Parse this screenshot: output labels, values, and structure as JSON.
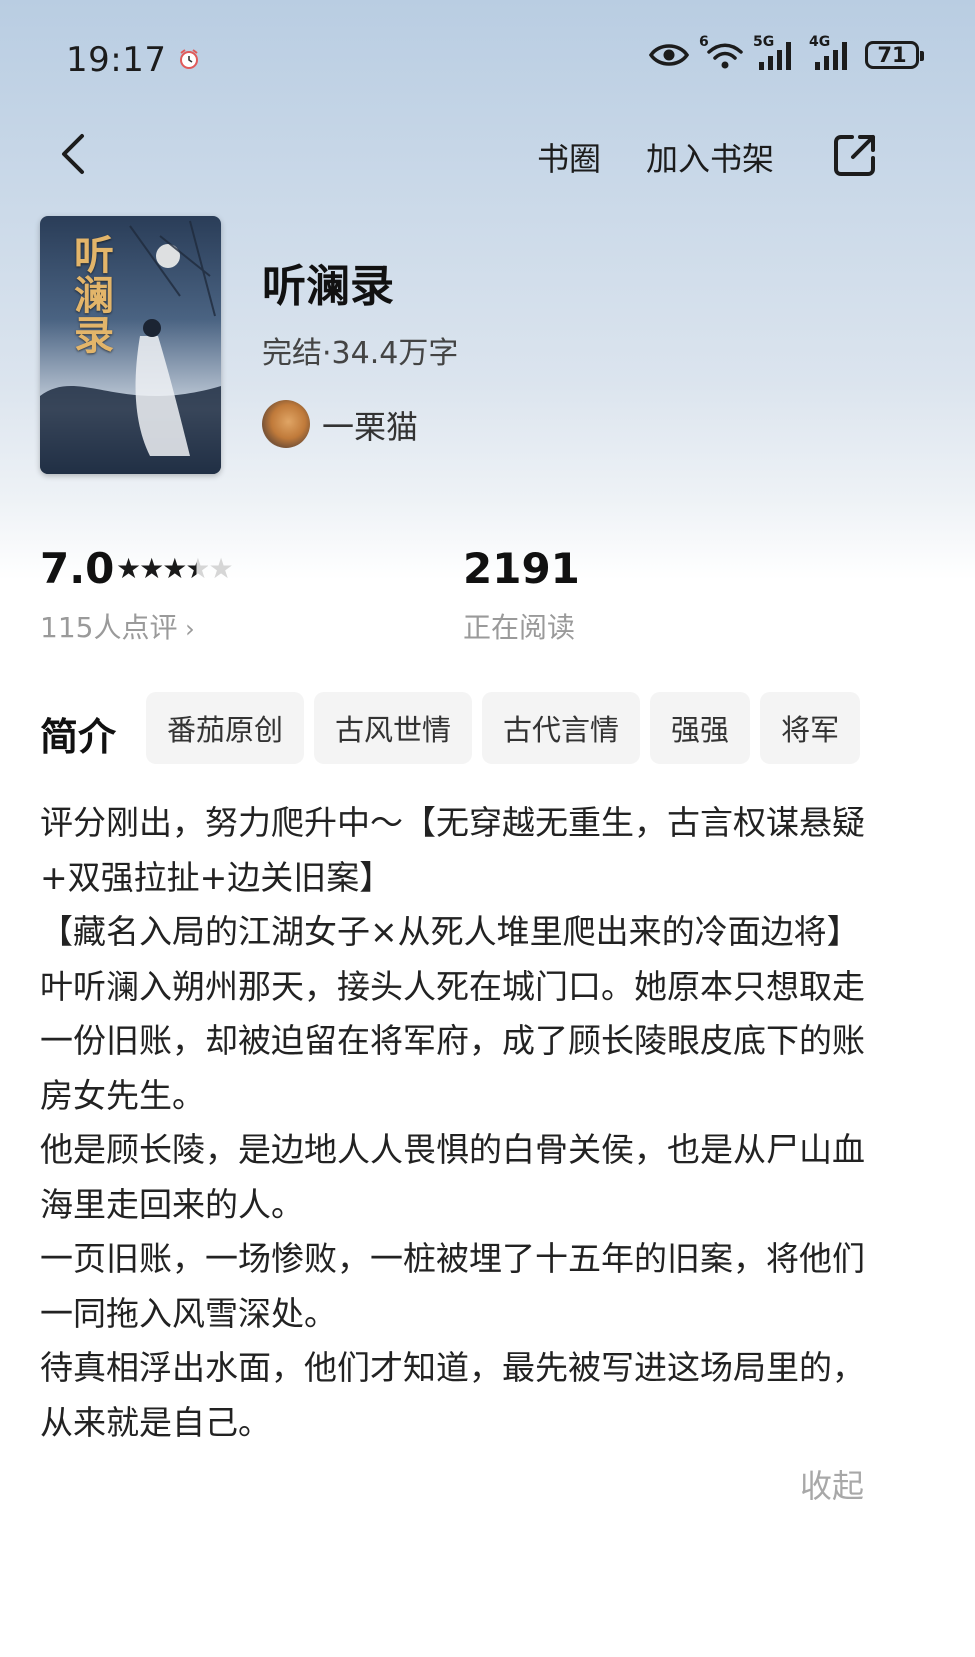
{
  "status_bar": {
    "time": "19:17",
    "battery": "71",
    "signal_labels": [
      "6",
      "5G",
      "4G"
    ],
    "icons": [
      "alarm-icon",
      "eye-icon",
      "wifi-icon",
      "signal-icon",
      "battery-icon"
    ]
  },
  "nav": {
    "back_icon": "chevron-left-icon",
    "book_circle": "书圈",
    "add_to_shelf": "加入书架",
    "share_icon": "share-icon"
  },
  "book": {
    "cover_text": "听澜录",
    "title": "听澜录",
    "meta": "完结·34.4万字",
    "author": "一栗猫"
  },
  "stats": {
    "score": "7.0",
    "rating_stars": 3.5,
    "max_stars": 5,
    "review_count": "115人点评",
    "reading_count": "2191",
    "reading_label": "正在阅读"
  },
  "intro": {
    "label": "简介",
    "tags": [
      "番茄原创",
      "古风世情",
      "古代言情",
      "强强",
      "将军"
    ],
    "paragraphs": [
      "评分刚出，努力爬升中～【无穿越无重生，古言权谋悬疑+双强拉扯+边关旧案】",
      "【藏名入局的江湖女子×从死人堆里爬出来的冷面边将】",
      "叶听澜入朔州那天，接头人死在城门口。她原本只想取走一份旧账，却被迫留在将军府，成了顾长陵眼皮底下的账房女先生。",
      "他是顾长陵，是边地人人畏惧的白骨关侯，也是从尸山血海里走回来的人。",
      "一页旧账，一场惨败，一桩被埋了十五年的旧案，将他们一同拖入风雪深处。",
      "待真相浮出水面，他们才知道，最先被写进这场局里的，从来就是自己。"
    ],
    "collapse": "收起"
  },
  "colors": {
    "header_gradient_top": "#b9cde2",
    "text_primary": "#111111",
    "text_secondary": "#9a9a9a",
    "tag_background": "#f4f4f4",
    "cover_title": "#e3b56a"
  }
}
